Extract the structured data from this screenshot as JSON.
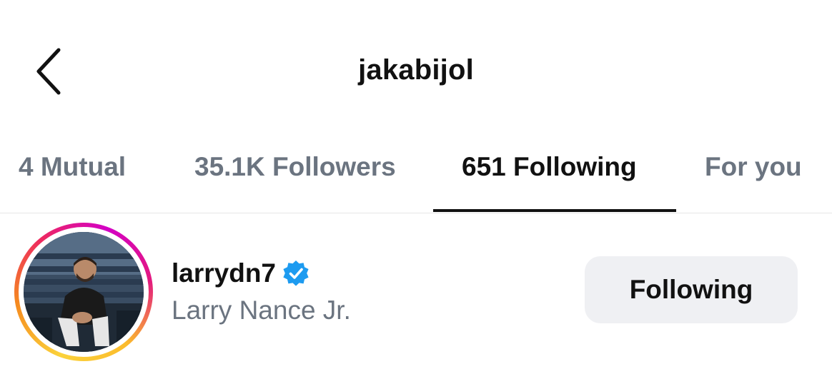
{
  "header": {
    "back_icon": "chevron-left-icon",
    "title": "jakabijol"
  },
  "tabs": [
    {
      "label": "4 Mutual",
      "active": false
    },
    {
      "label": "35.1K Followers",
      "active": false
    },
    {
      "label": "651 Following",
      "active": true
    },
    {
      "label": "For you",
      "active": false
    }
  ],
  "list": [
    {
      "username": "larrydn7",
      "verified": true,
      "display_name": "Larry Nance Jr.",
      "button_label": "Following"
    }
  ],
  "colors": {
    "text_primary": "#111111",
    "text_secondary": "#6b7480",
    "verified_badge": "#1d9bf0",
    "button_bg": "#eff0f3",
    "divider": "#e6e6e6"
  }
}
